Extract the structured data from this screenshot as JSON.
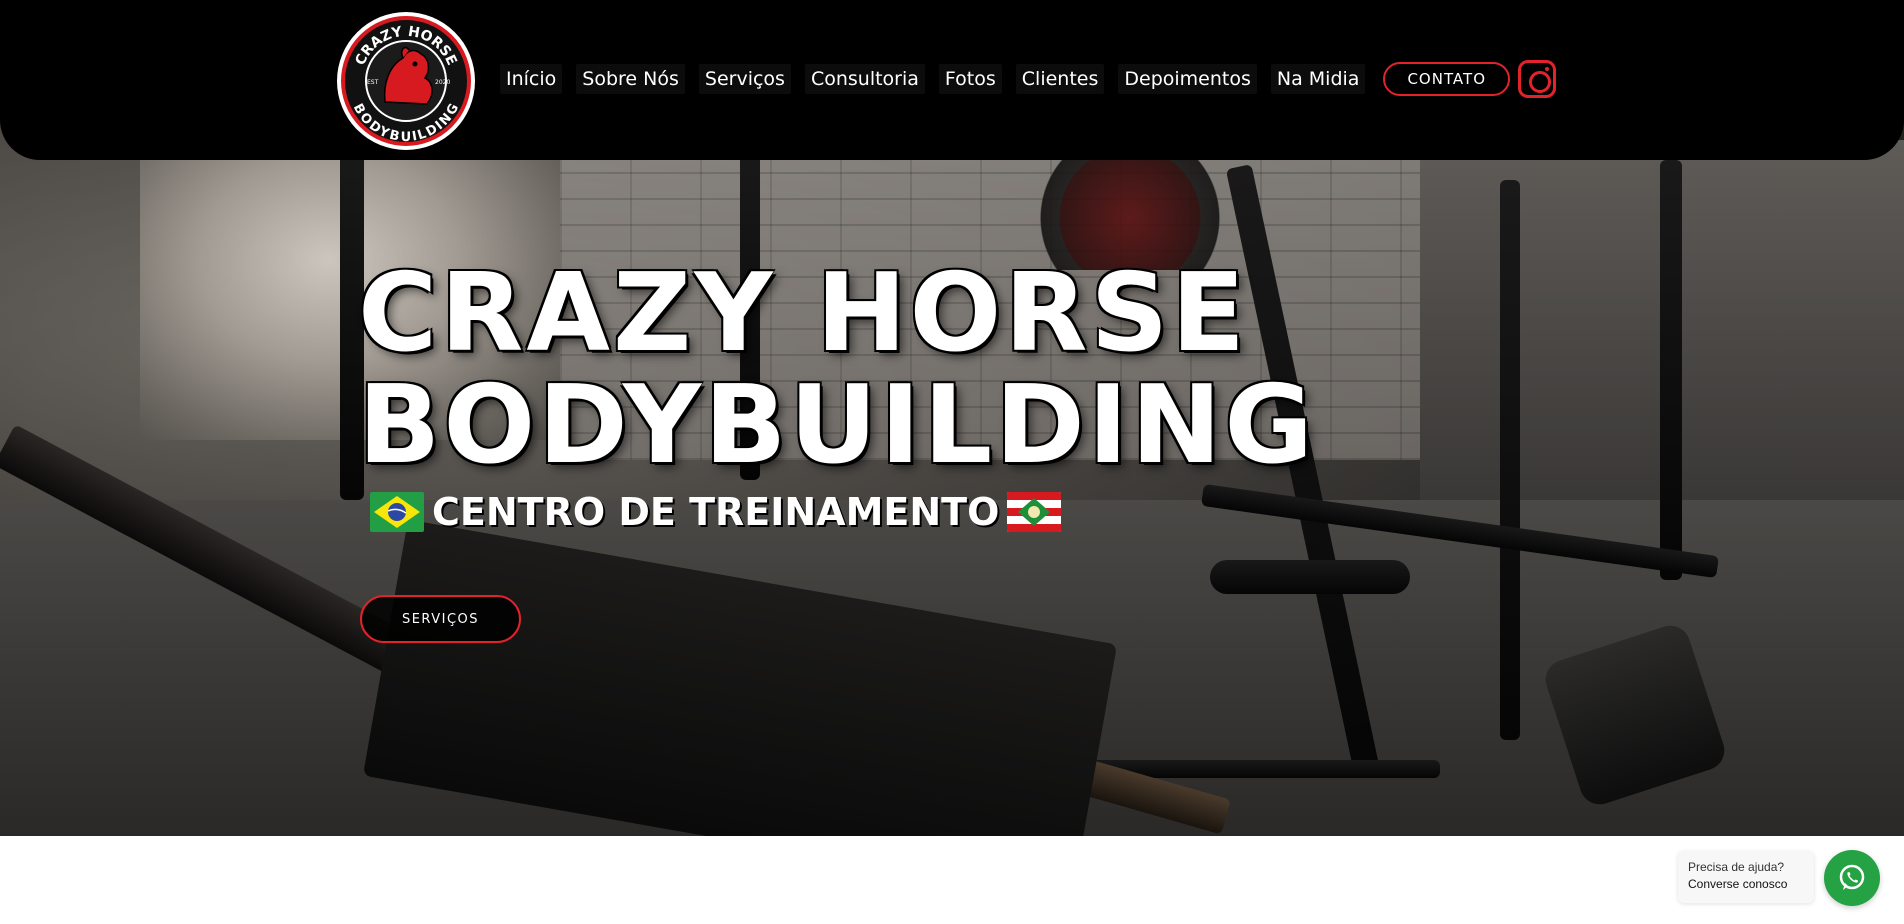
{
  "header": {
    "logo": {
      "top_text": "CRAZY HORSE",
      "bottom_text": "BODYBUILDING",
      "est_left": "EST",
      "est_right": "2020"
    },
    "nav": [
      {
        "label": "Início"
      },
      {
        "label": "Sobre Nós"
      },
      {
        "label": "Serviços"
      },
      {
        "label": "Consultoria"
      },
      {
        "label": "Fotos"
      },
      {
        "label": "Clientes"
      },
      {
        "label": "Depoimentos"
      },
      {
        "label": "Na Midia"
      }
    ],
    "cta_label": "CONTATO",
    "social_icon": "instagram-icon"
  },
  "hero": {
    "title_line1": "CRAZY HORSE",
    "title_line2": "BODYBUILDING",
    "subtitle": "CENTRO DE TREINAMENTO",
    "button_label": "SERVIÇOS"
  },
  "chat": {
    "question": "Precisa de ajuda?",
    "action": "Converse conosco",
    "icon": "whatsapp-icon"
  },
  "colors": {
    "accent_red": "#e2232a",
    "header_bg": "#000000",
    "whatsapp_green": "#25a244"
  }
}
